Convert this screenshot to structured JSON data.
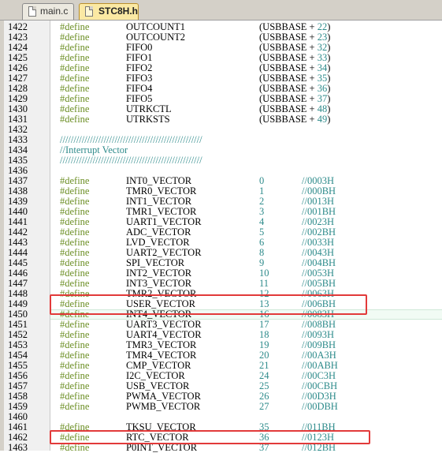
{
  "tabs": [
    {
      "label": "main.c",
      "active": false
    },
    {
      "label": "STC8H.h",
      "active": true
    }
  ],
  "keyword": "#define",
  "highlight_color": "#e23a3a",
  "lines": [
    {
      "n": "1422",
      "kind": "def",
      "name": "OUTCOUNT1",
      "pre": "(USBBASE + ",
      "num": "22",
      "post": ")"
    },
    {
      "n": "1423",
      "kind": "def",
      "name": "OUTCOUNT2",
      "pre": "(USBBASE + ",
      "num": "23",
      "post": ")"
    },
    {
      "n": "1424",
      "kind": "def",
      "name": "FIFO0",
      "pre": "(USBBASE + ",
      "num": "32",
      "post": ")"
    },
    {
      "n": "1425",
      "kind": "def",
      "name": "FIFO1",
      "pre": "(USBBASE + ",
      "num": "33",
      "post": ")"
    },
    {
      "n": "1426",
      "kind": "def",
      "name": "FIFO2",
      "pre": "(USBBASE + ",
      "num": "34",
      "post": ")"
    },
    {
      "n": "1427",
      "kind": "def",
      "name": "FIFO3",
      "pre": "(USBBASE + ",
      "num": "35",
      "post": ")"
    },
    {
      "n": "1428",
      "kind": "def",
      "name": "FIFO4",
      "pre": "(USBBASE + ",
      "num": "36",
      "post": ")"
    },
    {
      "n": "1429",
      "kind": "def",
      "name": "FIFO5",
      "pre": "(USBBASE + ",
      "num": "37",
      "post": ")"
    },
    {
      "n": "1430",
      "kind": "def",
      "name": "UTRKCTL",
      "pre": "(USBBASE + ",
      "num": "48",
      "post": ")"
    },
    {
      "n": "1431",
      "kind": "def",
      "name": "UTRKSTS",
      "pre": "(USBBASE + ",
      "num": "49",
      "post": ")"
    },
    {
      "n": "1432",
      "kind": "blank"
    },
    {
      "n": "1433",
      "kind": "comment",
      "text": "////////////////////////////////////////////////////"
    },
    {
      "n": "1434",
      "kind": "comment",
      "text": "//Interrupt Vector"
    },
    {
      "n": "1435",
      "kind": "comment",
      "text": "////////////////////////////////////////////////////"
    },
    {
      "n": "1436",
      "kind": "blank"
    },
    {
      "n": "1437",
      "kind": "vec",
      "name": "INT0_VECTOR",
      "num": "0",
      "comment": "//0003H"
    },
    {
      "n": "1438",
      "kind": "vec",
      "name": "TMR0_VECTOR",
      "num": "1",
      "comment": "//000BH"
    },
    {
      "n": "1439",
      "kind": "vec",
      "name": "INT1_VECTOR",
      "num": "2",
      "comment": "//0013H"
    },
    {
      "n": "1440",
      "kind": "vec",
      "name": "TMR1_VECTOR",
      "num": "3",
      "comment": "//001BH"
    },
    {
      "n": "1441",
      "kind": "vec",
      "name": "UART1_VECTOR",
      "num": "4",
      "comment": "//0023H"
    },
    {
      "n": "1442",
      "kind": "vec",
      "name": "ADC_VECTOR",
      "num": "5",
      "comment": "//002BH"
    },
    {
      "n": "1443",
      "kind": "vec",
      "name": "LVD_VECTOR",
      "num": "6",
      "comment": "//0033H"
    },
    {
      "n": "1444",
      "kind": "vec",
      "name": "UART2_VECTOR",
      "num": "8",
      "comment": "//0043H"
    },
    {
      "n": "1445",
      "kind": "vec",
      "name": "SPI_VECTOR",
      "num": "9",
      "comment": "//004BH"
    },
    {
      "n": "1446",
      "kind": "vec",
      "name": "INT2_VECTOR",
      "num": "10",
      "comment": "//0053H"
    },
    {
      "n": "1447",
      "kind": "vec",
      "name": "INT3_VECTOR",
      "num": "11",
      "comment": "//005BH"
    },
    {
      "n": "1448",
      "kind": "vec",
      "name": "TMR2_VECTOR",
      "num": "12",
      "comment": "//0063H"
    },
    {
      "n": "1449",
      "kind": "vec",
      "name": "USER_VECTOR",
      "num": "13",
      "comment": "//006BH"
    },
    {
      "n": "1450",
      "kind": "vec",
      "name": "INT4_VECTOR",
      "num": "16",
      "comment": "//0083H"
    },
    {
      "n": "1451",
      "kind": "vec",
      "name": "UART3_VECTOR",
      "num": "17",
      "comment": "//008BH"
    },
    {
      "n": "1452",
      "kind": "vec",
      "name": "UART4_VECTOR",
      "num": "18",
      "comment": "//0093H"
    },
    {
      "n": "1453",
      "kind": "vec",
      "name": "TMR3_VECTOR",
      "num": "19",
      "comment": "//009BH"
    },
    {
      "n": "1454",
      "kind": "vec",
      "name": "TMR4_VECTOR",
      "num": "20",
      "comment": "//00A3H"
    },
    {
      "n": "1455",
      "kind": "vec",
      "name": "CMP_VECTOR",
      "num": "21",
      "comment": "//00ABH"
    },
    {
      "n": "1456",
      "kind": "vec",
      "name": "I2C_VECTOR",
      "num": "24",
      "comment": "//00C3H"
    },
    {
      "n": "1457",
      "kind": "vec",
      "name": "USB_VECTOR",
      "num": "25",
      "comment": "//00CBH"
    },
    {
      "n": "1458",
      "kind": "vec",
      "name": "PWMA_VECTOR",
      "num": "26",
      "comment": "//00D3H"
    },
    {
      "n": "1459",
      "kind": "vec",
      "name": "PWMB_VECTOR",
      "num": "27",
      "comment": "//00DBH"
    },
    {
      "n": "1460",
      "kind": "blank"
    },
    {
      "n": "1461",
      "kind": "vec",
      "name": "TKSU_VECTOR",
      "num": "35",
      "comment": "//011BH"
    },
    {
      "n": "1462",
      "kind": "vec",
      "name": "RTC_VECTOR",
      "num": "36",
      "comment": "//0123H"
    },
    {
      "n": "1463",
      "kind": "vec",
      "name": "P0INT_VECTOR",
      "num": "37",
      "comment": "//012BH"
    }
  ]
}
